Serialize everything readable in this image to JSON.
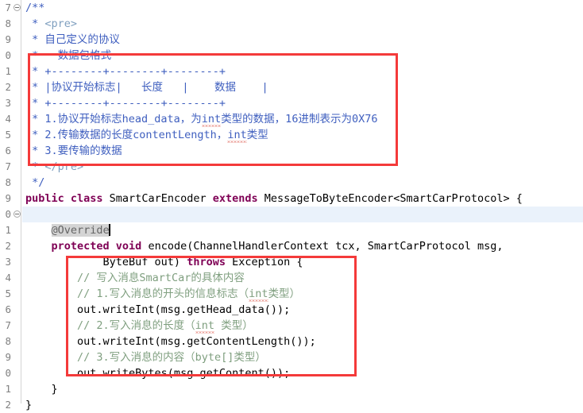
{
  "editor": {
    "file_language": "java",
    "colors": {
      "background": "#ffffff",
      "gutter_text": "#808080",
      "keyword": "#7f0055",
      "javadoc": "#3f5fbf",
      "javadoc_tag": "#7f9fbf",
      "line_comment": "#7f9f7f",
      "annotation": "#646464",
      "current_line": "#eaf2fb",
      "occurrence_highlight": "#d4d4d4",
      "annotation_box": "#f43a3a",
      "spellcheck_squiggle": "#d94a3d"
    },
    "gutter": {
      "note": "line numbers are clipped at the left edge; only the last digit is visible",
      "numbers": [
        "7",
        "8",
        "9",
        "0",
        "1",
        "2",
        "3",
        "4",
        "5",
        "6",
        "7",
        "8",
        "9",
        "0",
        "1",
        "2",
        "3",
        "4",
        "5",
        "6",
        "7",
        "8",
        "9",
        "0",
        "1",
        "2"
      ],
      "fold_markers": [
        0,
        13
      ]
    },
    "current_line_index": 13,
    "caret_line_index": 13,
    "lines": [
      {
        "id": "l17",
        "segments": [
          {
            "cls": "jdoc",
            "text": "/**"
          }
        ]
      },
      {
        "id": "l18",
        "segments": [
          {
            "cls": "jdoc",
            "text": " * "
          },
          {
            "cls": "jdoc-tag",
            "text": "<pre>"
          }
        ]
      },
      {
        "id": "l19",
        "segments": [
          {
            "cls": "jdoc",
            "text": " * 自己定义的协议"
          }
        ]
      },
      {
        "id": "l20",
        "segments": [
          {
            "cls": "jdoc",
            "text": " *   数据包格式"
          }
        ]
      },
      {
        "id": "l21",
        "segments": [
          {
            "cls": "jdoc",
            "text": " * +--------+--------+--------+"
          }
        ]
      },
      {
        "id": "l22",
        "segments": [
          {
            "cls": "jdoc",
            "text": " * |协议开始标志|   长度   |    数据    |"
          }
        ]
      },
      {
        "id": "l23",
        "segments": [
          {
            "cls": "jdoc",
            "text": " * +--------+--------+--------+"
          }
        ]
      },
      {
        "id": "l24",
        "segments": [
          {
            "cls": "jdoc",
            "text": " * 1.协议开始标志head_data，为"
          },
          {
            "cls": "jdoc sq",
            "text": "int"
          },
          {
            "cls": "jdoc",
            "text": "类型的数据，16进制表示为0X76"
          }
        ]
      },
      {
        "id": "l25",
        "segments": [
          {
            "cls": "jdoc",
            "text": " * 2.传输数据的长度contentLength，"
          },
          {
            "cls": "jdoc sq",
            "text": "int"
          },
          {
            "cls": "jdoc",
            "text": "类型"
          }
        ]
      },
      {
        "id": "l26",
        "segments": [
          {
            "cls": "jdoc",
            "text": " * 3.要传输的数据"
          }
        ]
      },
      {
        "id": "l27",
        "segments": [
          {
            "cls": "jdoc",
            "text": " * "
          },
          {
            "cls": "jdoc-tag",
            "text": "</pre>"
          }
        ]
      },
      {
        "id": "l28",
        "segments": [
          {
            "cls": "jdoc",
            "text": " */"
          }
        ]
      },
      {
        "id": "l29",
        "segments": [
          {
            "cls": "kw",
            "text": "public class"
          },
          {
            "cls": "plain",
            "text": " SmartCarEncoder "
          },
          {
            "cls": "kw",
            "text": "extends"
          },
          {
            "cls": "plain",
            "text": " MessageToByteEncoder<SmartCarProtocol> {"
          }
        ]
      },
      {
        "id": "l30",
        "segments": [
          {
            "cls": "plain",
            "text": ""
          }
        ]
      },
      {
        "id": "l31",
        "segments": [
          {
            "cls": "plain",
            "text": "    "
          },
          {
            "cls": "anno occ",
            "text": "@Override"
          }
        ],
        "caret_after": true
      },
      {
        "id": "l32",
        "segments": [
          {
            "cls": "plain",
            "text": "    "
          },
          {
            "cls": "kw",
            "text": "protected void"
          },
          {
            "cls": "plain",
            "text": " encode(ChannelHandlerContext tcx, SmartCarProtocol msg,"
          }
        ]
      },
      {
        "id": "l33",
        "segments": [
          {
            "cls": "plain",
            "text": "            ByteBuf out) "
          },
          {
            "cls": "kw",
            "text": "throws"
          },
          {
            "cls": "plain",
            "text": " Exception {"
          }
        ]
      },
      {
        "id": "l34",
        "segments": [
          {
            "cls": "cmt",
            "text": "        // 写入消息SmartCar的具体内容"
          }
        ]
      },
      {
        "id": "l35",
        "segments": [
          {
            "cls": "cmt",
            "text": "        // 1.写入消息的开头的信息标志（"
          },
          {
            "cls": "cmt sq",
            "text": "int"
          },
          {
            "cls": "cmt",
            "text": "类型）"
          }
        ]
      },
      {
        "id": "l36",
        "segments": [
          {
            "cls": "plain",
            "text": "        out.writeInt(msg.getHead_data());"
          }
        ]
      },
      {
        "id": "l37",
        "segments": [
          {
            "cls": "cmt",
            "text": "        // 2.写入消息的长度（"
          },
          {
            "cls": "cmt sq",
            "text": "int"
          },
          {
            "cls": "cmt",
            "text": " 类型）"
          }
        ]
      },
      {
        "id": "l38",
        "segments": [
          {
            "cls": "plain",
            "text": "        out.writeInt(msg.getContentLength());"
          }
        ]
      },
      {
        "id": "l39",
        "segments": [
          {
            "cls": "cmt",
            "text": "        // 3.写入消息的内容（byte[]类型）"
          }
        ]
      },
      {
        "id": "l40",
        "segments": [
          {
            "cls": "plain",
            "text": "        out.writeBytes(msg.getContent());"
          }
        ]
      },
      {
        "id": "l41",
        "segments": [
          {
            "cls": "plain",
            "text": "    }"
          }
        ]
      },
      {
        "id": "l42",
        "segments": [
          {
            "cls": "plain",
            "text": "}"
          }
        ]
      }
    ],
    "annotation_boxes": [
      {
        "id": "redbox-1",
        "label": "protocol-format-comment-highlight"
      },
      {
        "id": "redbox-2",
        "label": "encode-method-body-highlight"
      }
    ]
  }
}
